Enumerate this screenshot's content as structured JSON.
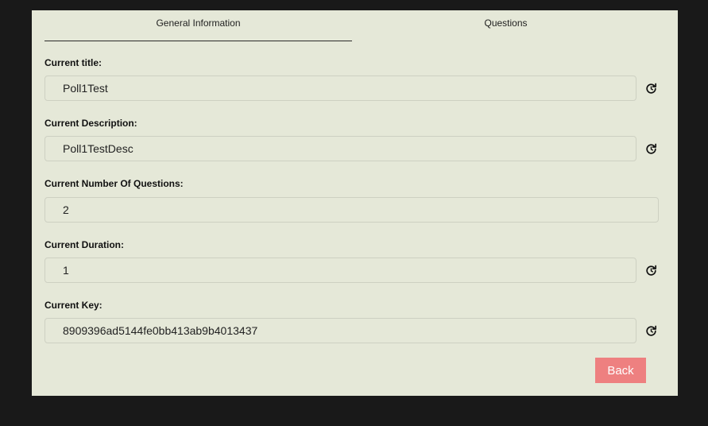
{
  "tabs": {
    "general": "General Information",
    "questions": "Questions"
  },
  "fields": [
    {
      "label": "Current title:",
      "value": "Poll1Test",
      "refresh_icon": "refresh-icon"
    },
    {
      "label": "Current Description:",
      "value": "Poll1TestDesc",
      "refresh_icon": "refresh-icon"
    },
    {
      "label": "Current Number Of Questions:",
      "value": "2"
    },
    {
      "label": "Current Duration:",
      "value": "1",
      "refresh_icon": "refresh-icon"
    },
    {
      "label": "Current Key:",
      "value": "8909396ad5144fe0bb413ab9b4013437",
      "refresh_icon": "refresh-icon"
    }
  ],
  "actions": {
    "back_label": "Back",
    "back_color": "#ee8080"
  },
  "colors": {
    "background": "#191919",
    "panel": "#e5e8d8"
  }
}
